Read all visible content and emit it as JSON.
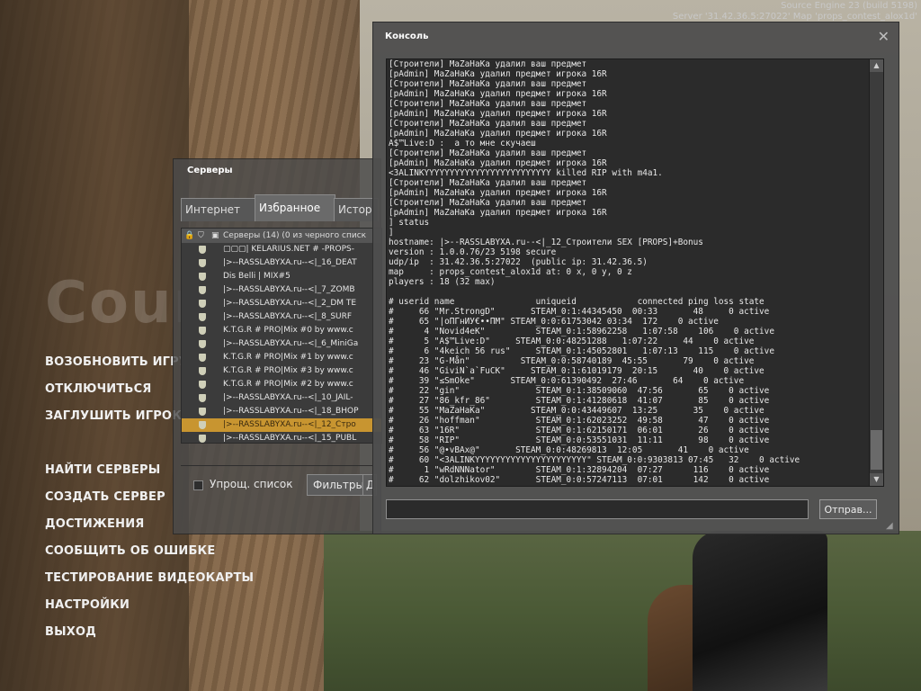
{
  "engine_info": {
    "line1": "Source Engine 23 (build 5198)",
    "line2": "Server '31.42.36.5:27022' Map 'props_contest_alox1d'"
  },
  "background_logo": "Counter-Strike",
  "menu": {
    "items_group1": [
      "ВОЗОБНОВИТЬ ИГРУ",
      "ОТКЛЮЧИТЬСЯ",
      "ЗАГЛУШИТЬ ИГРОКО"
    ],
    "items_group2": [
      "НАЙТИ СЕРВЕРЫ",
      "СОЗДАТЬ СЕРВЕР",
      "ДОСТИЖЕНИЯ",
      "СООБЩИТЬ ОБ ОШИБКЕ",
      "ТЕСТИРОВАНИЕ ВИДЕОКАРТЫ",
      "НАСТРОЙКИ",
      "ВЫХОД"
    ]
  },
  "servers": {
    "title": "Серверы",
    "tabs": [
      "Интернет",
      "Избранное",
      "Истор"
    ],
    "active_tab": "Избранное",
    "header": "Серверы (14) (0 из черного списк",
    "rows": [
      "▢▢▢| KELARIUS.NET # -PROPS-",
      "|>--RASSLABYXA.ru--<|_16_DEAT",
      "Dis Belli | MIX#5",
      "|>--RASSLABYXA.ru--<|_7_ZOMB",
      "|>--RASSLABYXA.ru--<|_2_DM TE",
      "|>--RASSLABYXA.ru--<|_8_SURF",
      "K.T.G.R #  PRO|Mix #0 by www.c",
      "|>--RASSLABYXA.ru--<|_6_MiniGa",
      "K.T.G.R #  PRO|Mix #1 by www.c",
      "K.T.G.R #  PRO|Mix #3 by www.c",
      "K.T.G.R #  PRO|Mix #2 by www.c",
      "|>--RASSLABYXA.ru--<|_10_JAIL-",
      "|>--RASSLABYXA.ru--<|_18_BHOP",
      "|>--RASSLABYXA.ru--<|_12_Стро",
      "|>--RASSLABYXA.ru--<|_15_PUBL"
    ],
    "selected_index": 13,
    "simple_list_label": "Упрощ. список",
    "filters_label": "Фильтры",
    "next_btn_label": "Д"
  },
  "console": {
    "title": "Консоль",
    "close_glyph": "✕",
    "submit_label": "Отправ...",
    "input_value": "",
    "lines": [
      "[Строители] MaZaHaKa удалил ваш предмет",
      "[pAdmin] MaZaHaKa удалил предмет игрока 16R",
      "[Строители] MaZaHaKa удалил ваш предмет",
      "[pAdmin] MaZaHaKa удалил предмет игрока 16R",
      "[Строители] MaZaHaKa удалил ваш предмет",
      "[pAdmin] MaZaHaKa удалил предмет игрока 16R",
      "[Строители] MaZaHaKa удалил ваш предмет",
      "[pAdmin] MaZaHaKa удалил предмет игрока 16R",
      "A$™Live:D :  а то мне скучаеш",
      "[Строители] MaZaHaKa удалил ваш предмет",
      "[pAdmin] MaZaHaKa удалил предмет игрока 16R",
      "<3ALINKYYYYYYYYYYYYYYYYYYYYYYYYY killed RIP with m4a1.",
      "[Строители] MaZaHaKa удалил ваш предмет",
      "[pAdmin] MaZaHaKa удалил предмет игрока 16R",
      "[Строители] MaZaHaKa удалил ваш предмет",
      "[pAdmin] MaZaHaKa удалил предмет игрока 16R",
      "] status",
      "]",
      "hostname: |>--RASSLABYXA.ru--<|_12_Строители SEX [PROPS]+Bonus",
      "version : 1.0.0.76/23 5198 secure",
      "udp/ip  : 31.42.36.5:27022  (public ip: 31.42.36.5)",
      "map     : props_contest_alox1d at: 0 x, 0 y, 0 z",
      "players : 18 (32 max)",
      "",
      "# userid name                uniqueid            connected ping loss state",
      "#     66 \"Mr.StrongD\"       STEAM_0:1:44345450  00:33       48     0 active",
      "#     65 \"|oПГнИУ€••ПМ\" STEAM_0:0:61753042 03:34  172    0 active",
      "#      4 \"Novid4eK\"          STEAM_0:1:58962258   1:07:58    106    0 active",
      "#      5 \"A$™Live:D\"     STEAM_0:0:48251288   1:07:22     44    0 active",
      "#      6 \"4keich 56 rus\"     STEAM_0:1:45052801   1:07:13    115    0 active",
      "#     23 \"G-Mån\"          STEAM_0:0:58740189  45:55       79    0 active",
      "#     46 \"GiviN`a`FuCK\"     STEAM_0:1:61019179  20:15       40    0 active",
      "#     39 \"≤SmOke\"       STEAM_0:0:61390492  27:46       64    0 active",
      "#     22 \"gin\"               STEAM_0:1:38509060  47:56       65    0 active",
      "#     27 \"86_kfr_86\"         STEAM_0:1:41280618  41:07       85    0 active",
      "#     55 \"MaZaHaKa\"         STEAM_0:0:43449607  13:25       35    0 active",
      "#     26 \"hoffman\"           STEAM_0:1:62023252  49:58       47    0 active",
      "#     63 \"16R\"               STEAM_0:1:62150171  06:01       26    0 active",
      "#     58 \"RIP\"               STEAM_0:0:53551031  11:11       98    0 active",
      "#     56 \"@•vBAx@\"       STEAM_0:0:48269813  12:05       41    0 active",
      "#     60 \"<3ALINKYYYYYYYYYYYYYYYYYYYYYY\" STEAM_0:0:9303813 07:45   32    0 active",
      "#      1 \"wRdNNNator\"        STEAM_0:1:32894204  07:27      116    0 active",
      "#     62 \"dolzhikov02\"       STEAM_0:0:57247113  07:01      142    0 active"
    ]
  }
}
